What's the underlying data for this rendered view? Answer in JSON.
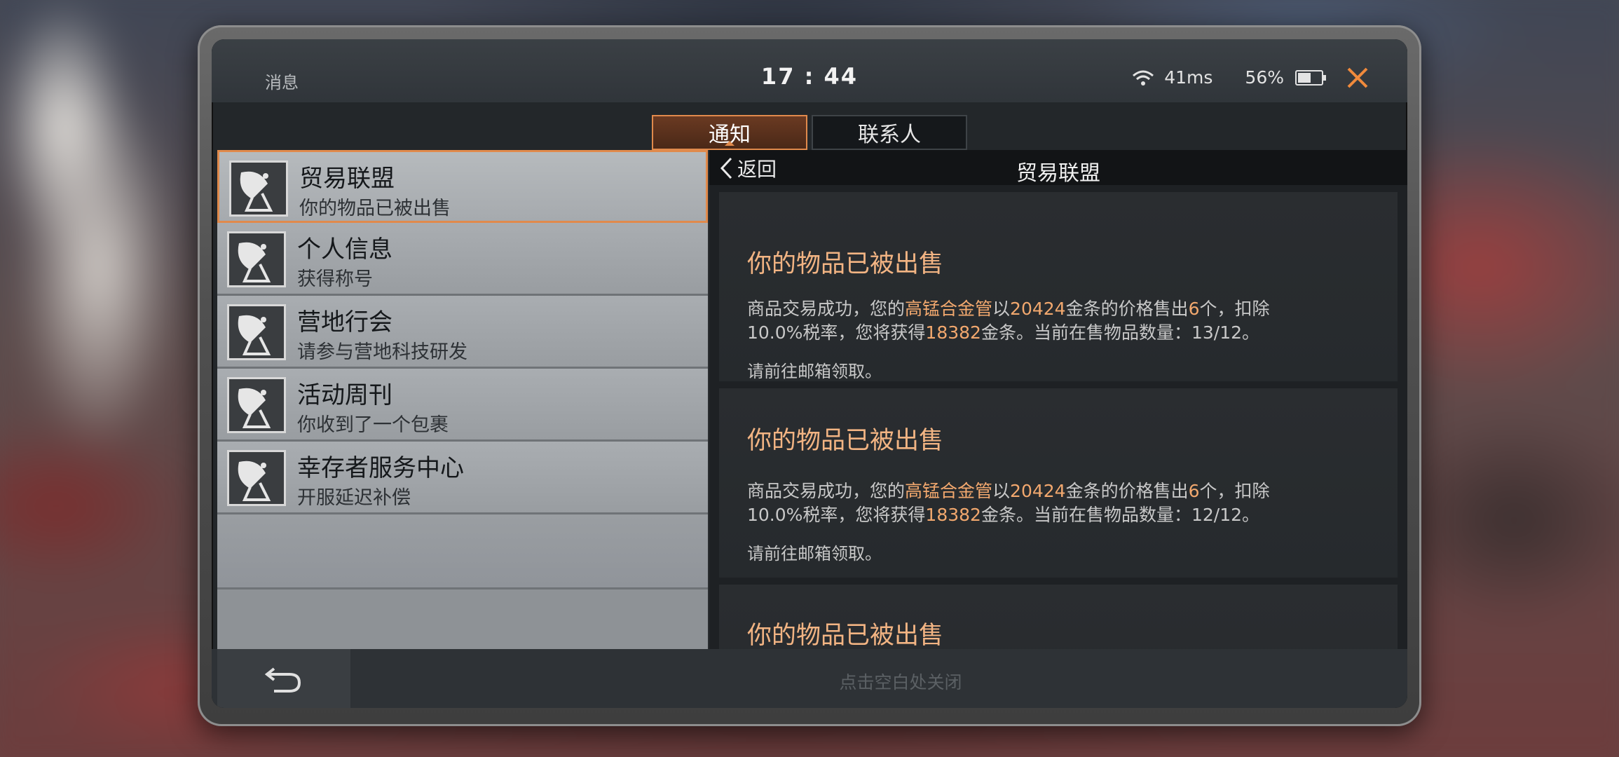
{
  "status_bar": {
    "app_name": "消息",
    "time": "17 : 44",
    "ping": "41ms",
    "battery": "56%",
    "battery_level": 0.56
  },
  "tabs": [
    {
      "label": "通知",
      "active": true
    },
    {
      "label": "联系人",
      "active": false
    }
  ],
  "notifications": [
    {
      "title": "贸易联盟",
      "subtitle": "你的物品已被出售",
      "selected": true
    },
    {
      "title": "个人信息",
      "subtitle": "获得称号",
      "selected": false
    },
    {
      "title": "营地行会",
      "subtitle": "请参与营地科技研发",
      "selected": false
    },
    {
      "title": "活动周刊",
      "subtitle": "你收到了一个包裹",
      "selected": false
    },
    {
      "title": "幸存者服务中心",
      "subtitle": "开服延迟补偿",
      "selected": false
    }
  ],
  "detail": {
    "back_label": "返回",
    "title": "贸易联盟",
    "messages": [
      {
        "title": "你的物品已被出售",
        "body_prefix": "商品交易成功，您的",
        "item": "高锰合金管",
        "mid1": "以",
        "price": "20424",
        "mid2": "金条的价格售出",
        "qty": "6",
        "mid3": "个，扣除",
        "line2_prefix": "10.0%税率，您将获得",
        "earned": "18382",
        "line2_suffix": "金条。当前在售物品数量：13/12。",
        "note": "请前往邮箱领取。"
      },
      {
        "title": "你的物品已被出售",
        "body_prefix": "商品交易成功，您的",
        "item": "高锰合金管",
        "mid1": "以",
        "price": "20424",
        "mid2": "金条的价格售出",
        "qty": "6",
        "mid3": "个，扣除",
        "line2_prefix": "10.0%税率，您将获得",
        "earned": "18382",
        "line2_suffix": "金条。当前在售物品数量：12/12。",
        "note": "请前往邮箱领取。"
      },
      {
        "title": "你的物品已被出售"
      }
    ]
  },
  "bottom_bar": {
    "hint": "点击空白处关闭"
  },
  "colors": {
    "accent": "#e08a4c",
    "highlight_text": "#f2a86e",
    "title_text": "#f2b483"
  },
  "icons": {
    "close": "close-icon",
    "back": "chevron-left-icon",
    "undo": "undo-arrow-icon",
    "notification": "satellite-dish-icon"
  }
}
